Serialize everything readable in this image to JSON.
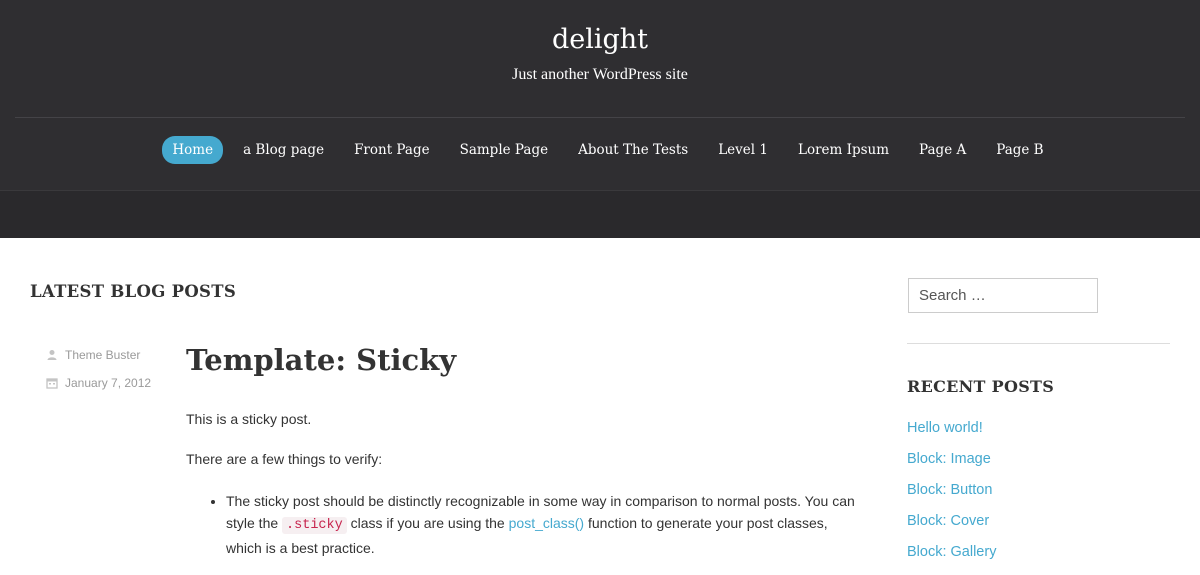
{
  "site": {
    "title": "delight",
    "tagline": "Just another WordPress site"
  },
  "nav": {
    "items": [
      {
        "label": "Home",
        "active": true
      },
      {
        "label": "a Blog page"
      },
      {
        "label": "Front Page"
      },
      {
        "label": "Sample Page"
      },
      {
        "label": "About The Tests"
      },
      {
        "label": "Level 1"
      },
      {
        "label": "Lorem Ipsum"
      },
      {
        "label": "Page A"
      },
      {
        "label": "Page B"
      }
    ]
  },
  "main": {
    "section_heading": "LATEST BLOG POSTS",
    "post": {
      "author": "Theme Buster",
      "author_icon": "user-icon",
      "date": "January 7, 2012",
      "date_icon": "calendar-icon",
      "title": "Template: Sticky",
      "paragraph_1": "This is a sticky post.",
      "paragraph_2": "There are a few things to verify:",
      "bullet_1": {
        "text_a": "The sticky post should be distinctly recognizable in some way in comparison to normal posts. You can style the ",
        "code": ".sticky",
        "text_b": " class if you are using the ",
        "link": "post_class()",
        "text_c": " function to generate your post classes, which is a best practice."
      }
    }
  },
  "sidebar": {
    "search_placeholder": "Search …",
    "recent_heading": "RECENT POSTS",
    "recent_posts": [
      "Hello world!",
      "Block: Image",
      "Block: Button",
      "Block: Cover",
      "Block: Gallery"
    ]
  },
  "colors": {
    "header_bg": "#2f2e31",
    "accent": "#45a9cf",
    "code_text": "#c7254e"
  }
}
